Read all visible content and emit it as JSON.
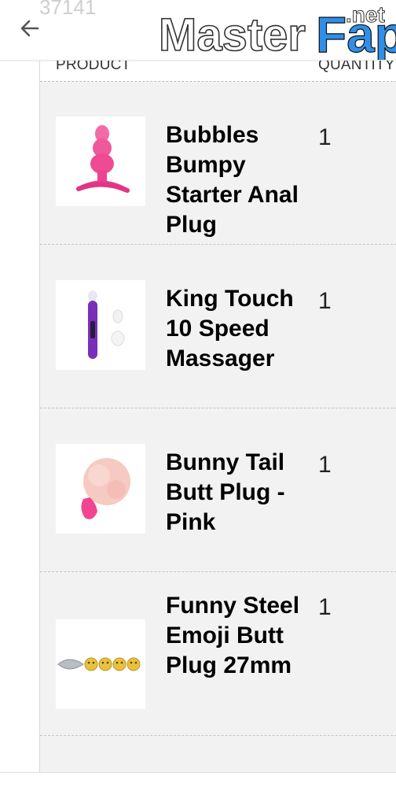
{
  "header": {
    "page_indicator": "37141",
    "watermark": {
      "master": "Master",
      "fap": "Fap",
      "net": ".net"
    },
    "colors": {
      "fap_blue": "#2f8fe8",
      "fap_pink": "#e6308a"
    }
  },
  "table": {
    "columns": [
      "PRODUCT",
      "QUANTITY"
    ],
    "rows": [
      {
        "name": "Bubbles Bumpy Starter Anal Plug",
        "quantity": "1",
        "thumb_icon": "pink-beaded-plug-icon"
      },
      {
        "name": "King Touch 10 Speed Massager",
        "quantity": "1",
        "thumb_icon": "purple-wand-massager-icon"
      },
      {
        "name": "Bunny Tail Butt Plug - Pink",
        "quantity": "1",
        "thumb_icon": "pink-bunny-tail-plug-icon"
      },
      {
        "name": "Funny Steel Emoji Butt Plug 27mm",
        "quantity": "1",
        "thumb_icon": "steel-emoji-plug-set-icon"
      }
    ]
  }
}
